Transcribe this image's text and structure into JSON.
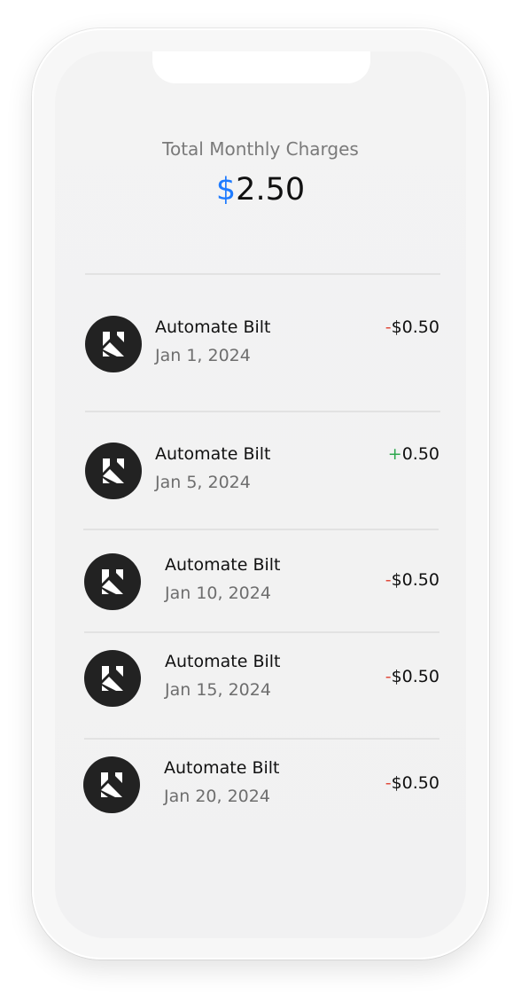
{
  "summary": {
    "label": "Total Monthly Charges",
    "currency_symbol": "$",
    "total": "2.50"
  },
  "transactions": [
    {
      "name": "Automate Bilt",
      "date": "Jan 1, 2024",
      "sign": "-",
      "amount": "$0.50",
      "icon": "bilt-logo-icon"
    },
    {
      "name": "Automate Bilt",
      "date": "Jan 5, 2024",
      "sign": "+",
      "amount": "0.50",
      "icon": "bilt-logo-icon"
    },
    {
      "name": "Automate Bilt",
      "date": "Jan 10, 2024",
      "sign": "-",
      "amount": "$0.50",
      "icon": "bilt-logo-icon"
    },
    {
      "name": "Automate Bilt",
      "date": "Jan 15, 2024",
      "sign": "-",
      "amount": "$0.50",
      "icon": "bilt-logo-icon"
    },
    {
      "name": "Automate Bilt",
      "date": "Jan 20, 2024",
      "sign": "-",
      "amount": "$0.50",
      "icon": "bilt-logo-icon"
    }
  ],
  "colors": {
    "accent": "#1e7bff",
    "negative": "#e04b3c",
    "positive": "#2fa84f",
    "logo_bg": "#222222"
  }
}
